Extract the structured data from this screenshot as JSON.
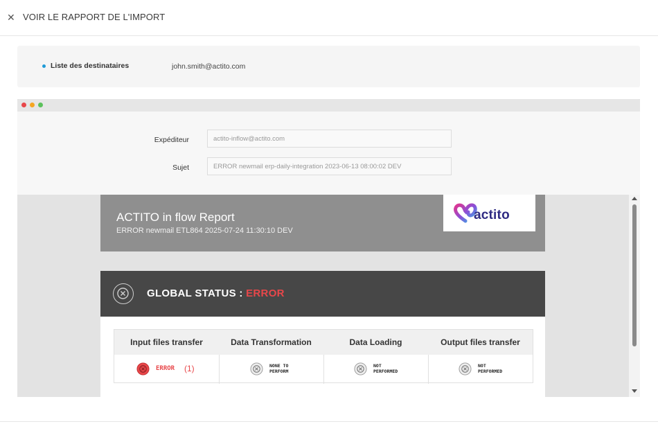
{
  "header": {
    "close_icon": "close-icon",
    "title": "VOIR LE RAPPORT DE L'IMPORT"
  },
  "recipients": {
    "label": "Liste des destinataires",
    "value": "john.smith@actito.com"
  },
  "email": {
    "window_dots": [
      "#e8474a",
      "#f5a623",
      "#5cc15c"
    ],
    "sender_label": "Expéditeur",
    "sender_value": "actito-inflow@actito.com",
    "subject_label": "Sujet",
    "subject_value": "ERROR newmail erp-daily-integration 2023-06-13 08:00:02 DEV"
  },
  "report": {
    "title": "ACTITO in flow Report",
    "subtitle": "ERROR newmail ETL864 2025-07-24 11:30:10 DEV",
    "logo_text": "actito",
    "status_label": "GLOBAL STATUS : ",
    "status_value": "ERROR",
    "status_color": "#e8474a",
    "steps": [
      {
        "name": "Input files transfer",
        "status": "ERROR",
        "count": "(1)",
        "icon": "error-icon"
      },
      {
        "name": "Data Transformation",
        "status_line1": "NONE TO",
        "status_line2": "PERFORM",
        "icon": "skipped-icon"
      },
      {
        "name": "Data Loading",
        "status_line1": "NOT",
        "status_line2": "PERFORMED",
        "icon": "skipped-icon"
      },
      {
        "name": "Output files transfer",
        "status_line1": "NOT",
        "status_line2": "PERFORMED",
        "icon": "skipped-icon"
      }
    ]
  }
}
